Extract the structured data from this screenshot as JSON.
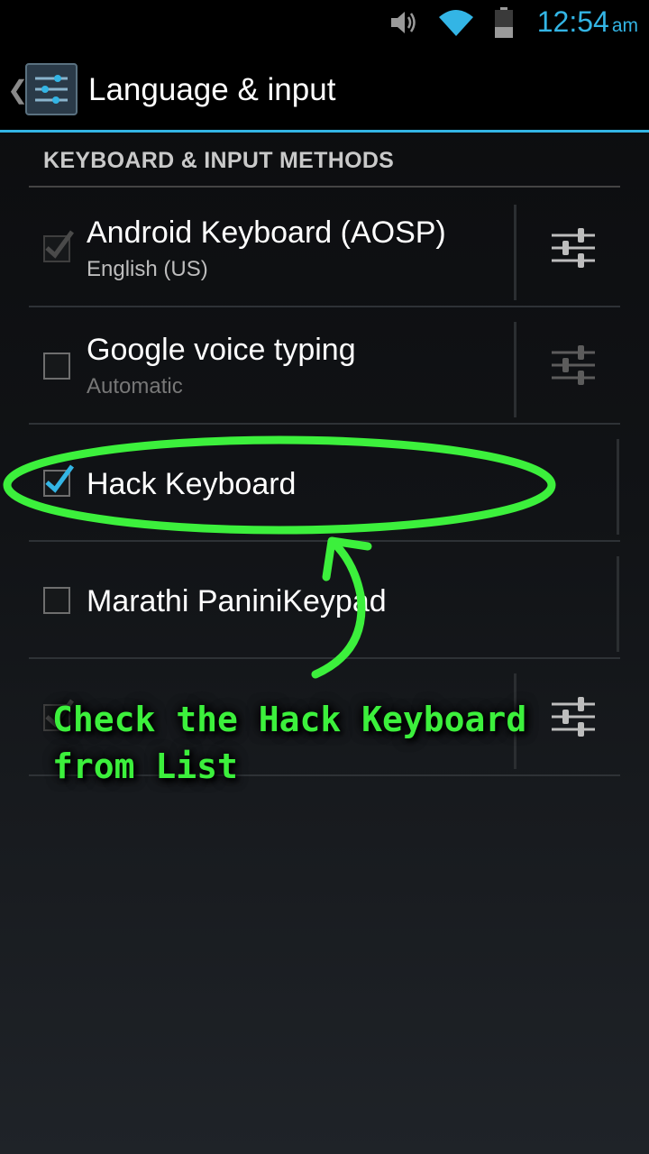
{
  "status_bar": {
    "time": "12:54",
    "ampm": "am",
    "icons": [
      "volume-icon",
      "wifi-icon",
      "battery-icon"
    ],
    "accent_color": "#33b5e5"
  },
  "action_bar": {
    "title": "Language & input",
    "icon": "settings-sliders-icon"
  },
  "section": {
    "header": "KEYBOARD & INPUT METHODS"
  },
  "input_methods": [
    {
      "title": "Android Keyboard (AOSP)",
      "summary": "English (US)",
      "checked": true,
      "enabled": false,
      "has_settings": true
    },
    {
      "title": "Google voice typing",
      "summary": "Automatic",
      "checked": false,
      "enabled": true,
      "has_settings": true
    },
    {
      "title": "Hack Keyboard",
      "summary": "",
      "checked": true,
      "enabled": true,
      "has_settings": false
    },
    {
      "title": "Marathi PaniniKeypad",
      "summary": "",
      "checked": false,
      "enabled": true,
      "has_settings": false
    },
    {
      "title": "",
      "summary": "",
      "checked": true,
      "enabled": false,
      "has_settings": true
    }
  ],
  "annotation": {
    "text_line1": "Check the Hack Keyboard",
    "text_line2": "from List",
    "color": "#3cf03c"
  }
}
